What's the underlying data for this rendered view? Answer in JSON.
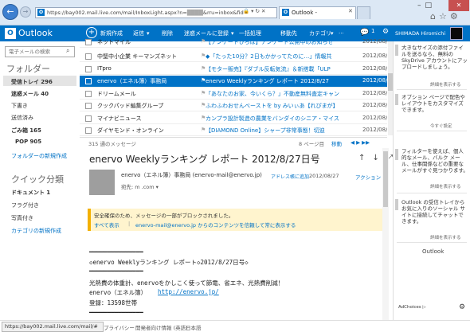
{
  "browser": {
    "url": "https://bay002.mail.live.com/mail/InboxLight.aspx?n=",
    "url_tail": "&rru=inbox&fid",
    "tab_title": "Outlook -",
    "window_controls": [
      "–",
      "□"
    ],
    "close": "✕",
    "toolbar_icons": [
      "⌂",
      "☆",
      "⚙"
    ]
  },
  "outlook": {
    "logo": "Outlook",
    "logo_glyph": "O",
    "commands": [
      "新規作成",
      "返信",
      "削除",
      "迷惑メールに登録",
      "一括処理",
      "移動先",
      "カテゴリ"
    ],
    "dropdown_glyph": "▾",
    "more": "···",
    "chat_count": "1",
    "user": "SHIMADA Hiromichi"
  },
  "nav": {
    "search_placeholder": "電子メールの検索",
    "folders_heading": "フォルダー",
    "folders": [
      {
        "name": "受信トレイ",
        "count": "296",
        "bold": true
      },
      {
        "name": "迷惑メール",
        "count": "40",
        "bold": true
      },
      {
        "name": "下書き",
        "count": "",
        "bold": false
      },
      {
        "name": "送信済み",
        "count": "",
        "bold": false
      },
      {
        "name": "ごみ箱",
        "count": "165",
        "bold": true
      },
      {
        "name": "POP",
        "count": "905",
        "bold": true
      }
    ],
    "new_folder": "フォルダーの新規作成",
    "quick_heading": "クイック分類",
    "quick": [
      {
        "name": "ドキュメント",
        "count": "1",
        "bold": true
      },
      {
        "name": "フラグ付き",
        "count": "",
        "bold": false
      },
      {
        "name": "写真付き",
        "count": "",
        "bold": false
      }
    ],
    "new_category": "カテゴリの新規作成"
  },
  "messages": [
    {
      "from": "ネットマイル",
      "subject": "【アンケートひろば】アンケート公開中のお知らせ",
      "date": "2012/08/"
    },
    {
      "from": "中堅中小企業 キーマンズネット",
      "subject": "◆「たった10分？2日もかかってたのに…」情報共",
      "date": "2012/08/"
    },
    {
      "from": "ITpro",
      "subject": "【モター販売】『ダブル反転気流』＆新搭載「ULP",
      "date": "2012/08/"
    },
    {
      "from": "enervo（エネル簿）事務局",
      "subject": "enervo Weeklyランキング レポート 2012/8/27",
      "date": "2012/08/"
    },
    {
      "from": "ドリームメール",
      "subject": "「あなたのお家、今いくら？」不動産無料査定キャン",
      "date": "2012/08/"
    },
    {
      "from": "クックパッド編集グループ",
      "subject": "ふわふわおせんべーストを by みいぃあ【れぴまが】",
      "date": "2012/08/"
    },
    {
      "from": "マイナビニュース",
      "subject": "カンプラ設計製造の農業をバンダイのシニア・マイス",
      "date": "2012/08/"
    },
    {
      "from": "ダイヤモンド・オンライン",
      "subject": "【DIAMOND Online】シャープ非常事態！切迫",
      "date": "2012/08/"
    }
  ],
  "list_footer": {
    "count": "315 通のメッセージ",
    "page": "8 ページ目",
    "move": "移動",
    "nav": "◀ ▶ ▶▶"
  },
  "reading": {
    "subject": "enervo Weeklyランキング レポート 2012/8/27日号",
    "actions": "↑ ↓ ⤢",
    "sender": "enervo（エネル簿）事務局 (enervo-mail@enervo.jp)",
    "add_to_contacts": "アドレス帳に追加",
    "date": "2012/08/27",
    "action_menu": "アクション ▾",
    "to": "宛先: m                .com ▾",
    "warning": "安全確保のため、メッセージの一部がブロックされました。",
    "show_all": "すべて表示",
    "sep": "|",
    "trust": "enervo-mail@enervo.jp からのコンテンツを信頼して常に表示する",
    "body": [
      "━━━━━━━━━━━━━━━",
      "◇enervo Weeklyランキング レポート◇2012/8/27日号◇",
      "━━━━━━━━━━━━━━━",
      "光熱費の体重計、enervoをかしこく使って節電、省エネ、光熱費削減！",
      "enervo（エネル簿）",
      "http://enervo.jp/",
      "登録：13598世帯",
      "━━━━━━━━━━━━━━━"
    ]
  },
  "ads": [
    {
      "text": "大きなサイズの添付ファイルを送るなら、無料の SkyDrive アカウントにアップロードしましょう。",
      "more": "詳細を表示する"
    },
    {
      "text": "オプション ページで配色やレイアウトをカスタマイズできます。",
      "more": "今すぐ設定"
    },
    {
      "text": "フィルターを使えば、個人的なメール、バルク メール、仕事関係などの重要なメールがすぐ見つかります。",
      "more": "詳細を表示する"
    },
    {
      "text": "Outlook の受信トレイからお気に入りのソーシャル サイトに接続してチャットできます。",
      "more": "詳細を表示する"
    }
  ],
  "ad_brand": "Outlook",
  "adchoices": "AdChoices ▷",
  "status": {
    "url": "https://bay002.mail.live.com/mail/#",
    "links": [
      "プライバシー",
      "開発者向け情報 (英語)",
      "日本語"
    ]
  }
}
